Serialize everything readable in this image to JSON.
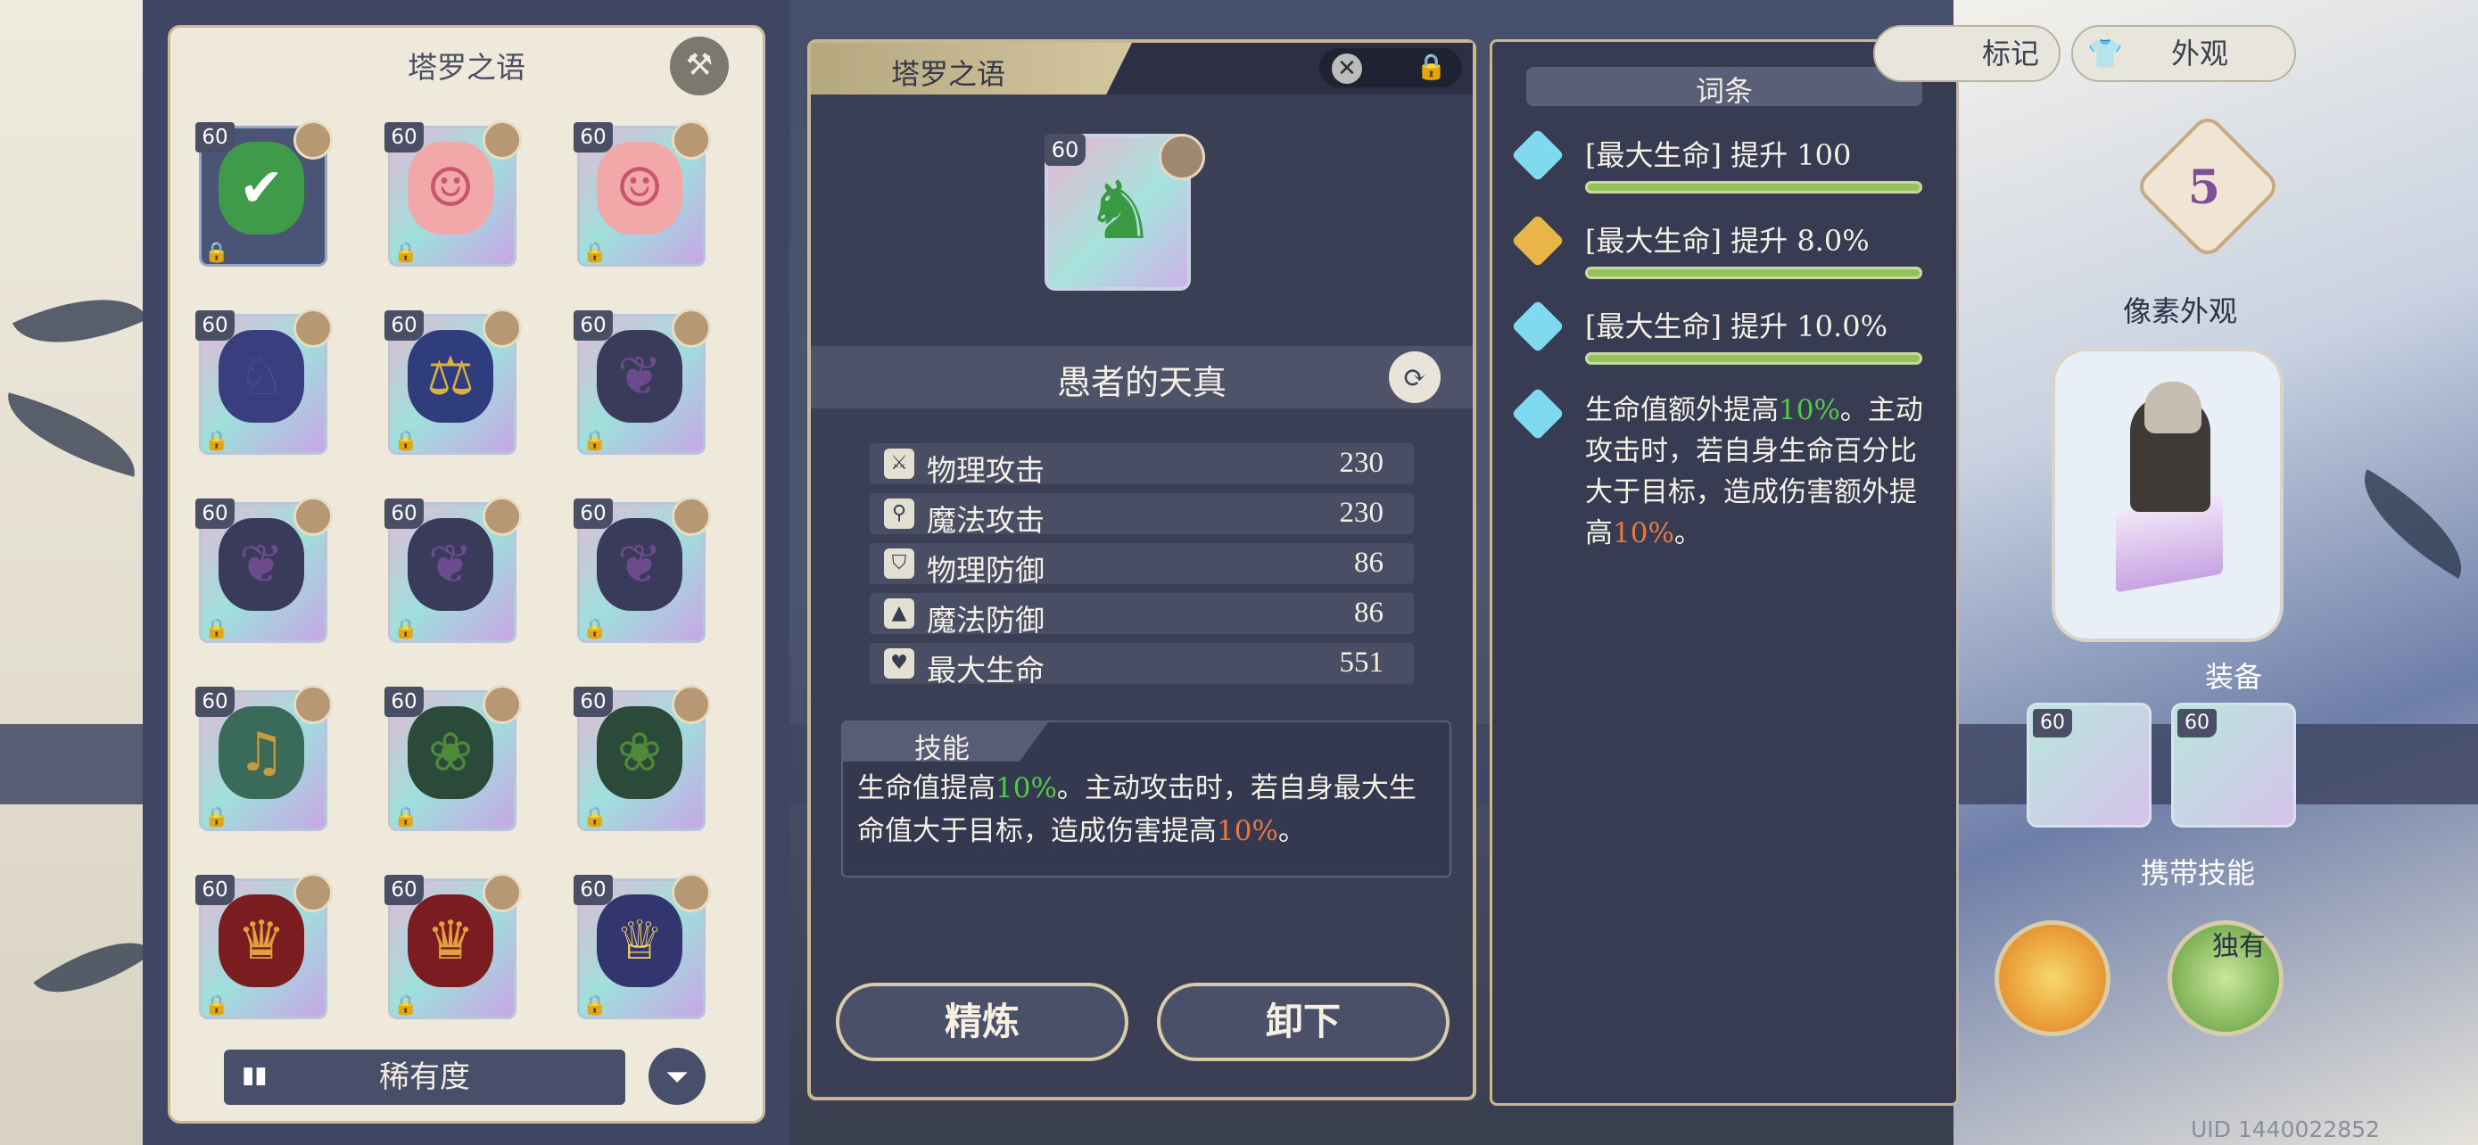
{
  "left_panel": {
    "title": "塔罗之语",
    "cards": [
      {
        "level": "60",
        "art": "check",
        "selected": true
      },
      {
        "level": "60",
        "art": "lady-portrait"
      },
      {
        "level": "60",
        "art": "lady-portrait"
      },
      {
        "level": "60",
        "art": "bat-wing-rabbit"
      },
      {
        "level": "60",
        "art": "scales"
      },
      {
        "level": "60",
        "art": "bat-wing"
      },
      {
        "level": "60",
        "art": "bat-wing"
      },
      {
        "level": "60",
        "art": "bat-wing"
      },
      {
        "level": "60",
        "art": "bat-wing"
      },
      {
        "level": "60",
        "art": "bell"
      },
      {
        "level": "60",
        "art": "wreath"
      },
      {
        "level": "60",
        "art": "wreath"
      },
      {
        "level": "60",
        "art": "crown-red"
      },
      {
        "level": "60",
        "art": "crown-red"
      },
      {
        "level": "60",
        "art": "crown-gold"
      }
    ],
    "sort_label": "稀有度"
  },
  "detail": {
    "header_title": "塔罗之语",
    "card_level": "60",
    "card_name": "愚者的天真",
    "stats": [
      {
        "icon": "sword-icon",
        "label": "物理攻击",
        "value": "230"
      },
      {
        "icon": "wand-icon",
        "label": "魔法攻击",
        "value": "230"
      },
      {
        "icon": "shield-icon",
        "label": "物理防御",
        "value": "86"
      },
      {
        "icon": "hat-icon",
        "label": "魔法防御",
        "value": "86"
      },
      {
        "icon": "heart-icon",
        "label": "最大生命",
        "value": "551"
      }
    ],
    "skill": {
      "label": "技能",
      "text_1": "生命值提高",
      "pct_1": "10%",
      "text_2": "。主动攻击时，若自身最大生命值大于目标，造成伤害提高",
      "pct_2": "10%",
      "text_3": "。"
    },
    "refine_label": "精炼",
    "unequip_label": "卸下"
  },
  "entries": {
    "title": "词条",
    "items": [
      {
        "text": "[最大生命] 提升 100",
        "color": "#7fd9ef"
      },
      {
        "text": "[最大生命] 提升 8.0%",
        "color": "#e8b548"
      },
      {
        "text": "[最大生命] 提升 10.0%",
        "color": "#7fd9ef"
      }
    ],
    "desc": {
      "a": "生命值额外提高",
      "b": "10%",
      "c": "。主动攻击时，若自身生命百分比大于目标，造成伤害额外提高",
      "d": "10%",
      "e": "。"
    }
  },
  "right": {
    "tab_mark": "标记",
    "tab_appearance": "外观",
    "level": "5",
    "pixel_label": "像素外观",
    "equip_label": "装备",
    "equip_levels": [
      "60",
      "60"
    ],
    "carry_label": "携带技能",
    "unique_label": "独有",
    "uid": "UID 1440022852"
  },
  "colors": {
    "accent_green": "#52c84a",
    "accent_orange": "#e77845",
    "panel_dark": "#3b3f55",
    "frame_gold": "#c8b78f"
  }
}
